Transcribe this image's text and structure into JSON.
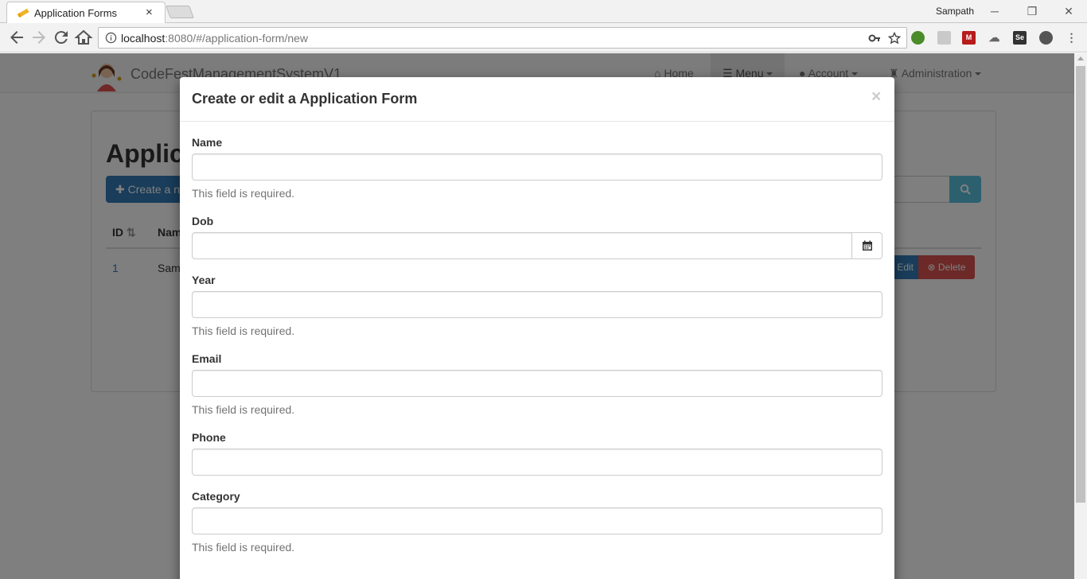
{
  "browser": {
    "tab_title": "Application Forms",
    "tab_close": "×",
    "profile_name": "Sampath",
    "url_host": "localhost",
    "url_rest": ":8080/#/application-form/new"
  },
  "navbar": {
    "brand": "CodeFestManagementSystemV1",
    "items": [
      {
        "label": "Home",
        "icon": "home-icon"
      },
      {
        "label": "Menu",
        "icon": "list-icon"
      },
      {
        "label": "Account",
        "icon": "user-icon"
      },
      {
        "label": "Administration",
        "icon": "tower-icon"
      }
    ]
  },
  "page": {
    "title": "Applica",
    "create_label": "Create a n",
    "columns": [
      "ID",
      "Nam"
    ],
    "rows": [
      {
        "id": "1",
        "name": "Sam"
      }
    ],
    "edit_label": "Edit",
    "delete_label": "Delete"
  },
  "modal": {
    "title": "Create or edit a Application Form",
    "close": "×",
    "fields": [
      {
        "label": "Name",
        "value": "",
        "help": "This field is required."
      },
      {
        "label": "Dob",
        "value": ""
      },
      {
        "label": "Year",
        "value": "",
        "help": "This field is required."
      },
      {
        "label": "Email",
        "value": "",
        "help": "This field is required."
      },
      {
        "label": "Phone",
        "value": ""
      },
      {
        "label": "Category",
        "value": "",
        "help": "This field is required."
      }
    ]
  },
  "colors": {
    "primary": "#337ab7",
    "danger": "#d9534f",
    "info": "#5bc0de"
  }
}
